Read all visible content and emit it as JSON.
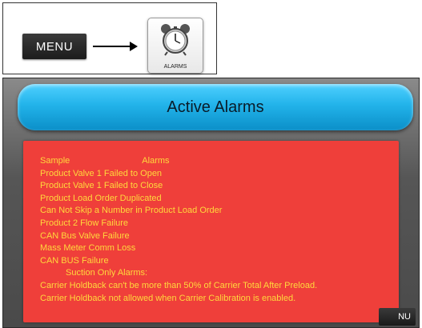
{
  "guide": {
    "menu_label": "MENU",
    "alarms_label": "ALARMS"
  },
  "screen": {
    "title": "Active Alarms",
    "header_left": "Sample",
    "header_right": "Alarms",
    "alarms": [
      "Product Valve 1 Failed to Open",
      "Product Valve 1 Failed to Close",
      "Product Load Order Duplicated",
      "Can Not Skip a Number in Product Load Order",
      "Product 2 Flow Failure",
      "CAN Bus Valve Failure",
      "Mass Meter Comm Loss",
      "CAN BUS Failure"
    ],
    "suction_heading": "Suction Only Alarms:",
    "suction_alarms": [
      "Carrier Holdback can't be more than 50% of Carrier Total After Preload.",
      "Carrier Holdback not allowed when Carrier Calibration is enabled."
    ],
    "menu_corner_label": "NU"
  },
  "colors": {
    "alarm_background": "#ef3f3a",
    "alarm_text": "#ffd93c",
    "title_bar": "#22b3ea"
  }
}
